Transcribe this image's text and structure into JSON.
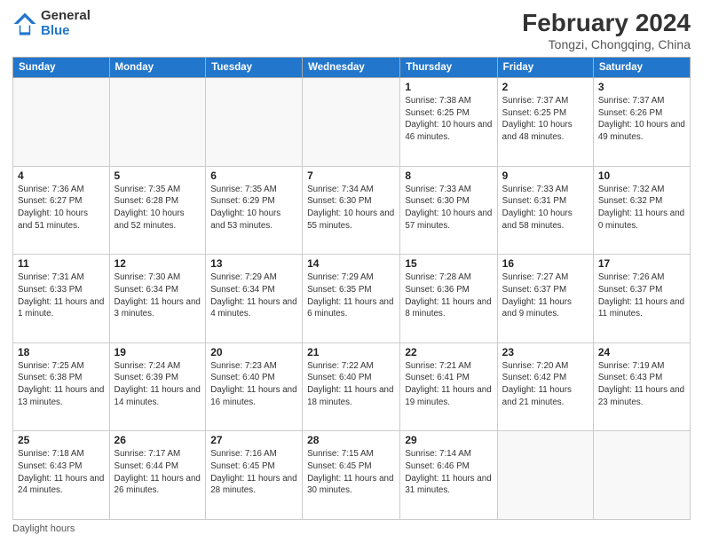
{
  "logo": {
    "general": "General",
    "blue": "Blue"
  },
  "header": {
    "title": "February 2024",
    "subtitle": "Tongzi, Chongqing, China"
  },
  "weekdays": [
    "Sunday",
    "Monday",
    "Tuesday",
    "Wednesday",
    "Thursday",
    "Friday",
    "Saturday"
  ],
  "weeks": [
    [
      {
        "day": "",
        "info": ""
      },
      {
        "day": "",
        "info": ""
      },
      {
        "day": "",
        "info": ""
      },
      {
        "day": "",
        "info": ""
      },
      {
        "day": "1",
        "info": "Sunrise: 7:38 AM\nSunset: 6:25 PM\nDaylight: 10 hours and 46 minutes."
      },
      {
        "day": "2",
        "info": "Sunrise: 7:37 AM\nSunset: 6:25 PM\nDaylight: 10 hours and 48 minutes."
      },
      {
        "day": "3",
        "info": "Sunrise: 7:37 AM\nSunset: 6:26 PM\nDaylight: 10 hours and 49 minutes."
      }
    ],
    [
      {
        "day": "4",
        "info": "Sunrise: 7:36 AM\nSunset: 6:27 PM\nDaylight: 10 hours and 51 minutes."
      },
      {
        "day": "5",
        "info": "Sunrise: 7:35 AM\nSunset: 6:28 PM\nDaylight: 10 hours and 52 minutes."
      },
      {
        "day": "6",
        "info": "Sunrise: 7:35 AM\nSunset: 6:29 PM\nDaylight: 10 hours and 53 minutes."
      },
      {
        "day": "7",
        "info": "Sunrise: 7:34 AM\nSunset: 6:30 PM\nDaylight: 10 hours and 55 minutes."
      },
      {
        "day": "8",
        "info": "Sunrise: 7:33 AM\nSunset: 6:30 PM\nDaylight: 10 hours and 57 minutes."
      },
      {
        "day": "9",
        "info": "Sunrise: 7:33 AM\nSunset: 6:31 PM\nDaylight: 10 hours and 58 minutes."
      },
      {
        "day": "10",
        "info": "Sunrise: 7:32 AM\nSunset: 6:32 PM\nDaylight: 11 hours and 0 minutes."
      }
    ],
    [
      {
        "day": "11",
        "info": "Sunrise: 7:31 AM\nSunset: 6:33 PM\nDaylight: 11 hours and 1 minute."
      },
      {
        "day": "12",
        "info": "Sunrise: 7:30 AM\nSunset: 6:34 PM\nDaylight: 11 hours and 3 minutes."
      },
      {
        "day": "13",
        "info": "Sunrise: 7:29 AM\nSunset: 6:34 PM\nDaylight: 11 hours and 4 minutes."
      },
      {
        "day": "14",
        "info": "Sunrise: 7:29 AM\nSunset: 6:35 PM\nDaylight: 11 hours and 6 minutes."
      },
      {
        "day": "15",
        "info": "Sunrise: 7:28 AM\nSunset: 6:36 PM\nDaylight: 11 hours and 8 minutes."
      },
      {
        "day": "16",
        "info": "Sunrise: 7:27 AM\nSunset: 6:37 PM\nDaylight: 11 hours and 9 minutes."
      },
      {
        "day": "17",
        "info": "Sunrise: 7:26 AM\nSunset: 6:37 PM\nDaylight: 11 hours and 11 minutes."
      }
    ],
    [
      {
        "day": "18",
        "info": "Sunrise: 7:25 AM\nSunset: 6:38 PM\nDaylight: 11 hours and 13 minutes."
      },
      {
        "day": "19",
        "info": "Sunrise: 7:24 AM\nSunset: 6:39 PM\nDaylight: 11 hours and 14 minutes."
      },
      {
        "day": "20",
        "info": "Sunrise: 7:23 AM\nSunset: 6:40 PM\nDaylight: 11 hours and 16 minutes."
      },
      {
        "day": "21",
        "info": "Sunrise: 7:22 AM\nSunset: 6:40 PM\nDaylight: 11 hours and 18 minutes."
      },
      {
        "day": "22",
        "info": "Sunrise: 7:21 AM\nSunset: 6:41 PM\nDaylight: 11 hours and 19 minutes."
      },
      {
        "day": "23",
        "info": "Sunrise: 7:20 AM\nSunset: 6:42 PM\nDaylight: 11 hours and 21 minutes."
      },
      {
        "day": "24",
        "info": "Sunrise: 7:19 AM\nSunset: 6:43 PM\nDaylight: 11 hours and 23 minutes."
      }
    ],
    [
      {
        "day": "25",
        "info": "Sunrise: 7:18 AM\nSunset: 6:43 PM\nDaylight: 11 hours and 24 minutes."
      },
      {
        "day": "26",
        "info": "Sunrise: 7:17 AM\nSunset: 6:44 PM\nDaylight: 11 hours and 26 minutes."
      },
      {
        "day": "27",
        "info": "Sunrise: 7:16 AM\nSunset: 6:45 PM\nDaylight: 11 hours and 28 minutes."
      },
      {
        "day": "28",
        "info": "Sunrise: 7:15 AM\nSunset: 6:45 PM\nDaylight: 11 hours and 30 minutes."
      },
      {
        "day": "29",
        "info": "Sunrise: 7:14 AM\nSunset: 6:46 PM\nDaylight: 11 hours and 31 minutes."
      },
      {
        "day": "",
        "info": ""
      },
      {
        "day": "",
        "info": ""
      }
    ]
  ],
  "footer": {
    "daylight_label": "Daylight hours"
  }
}
